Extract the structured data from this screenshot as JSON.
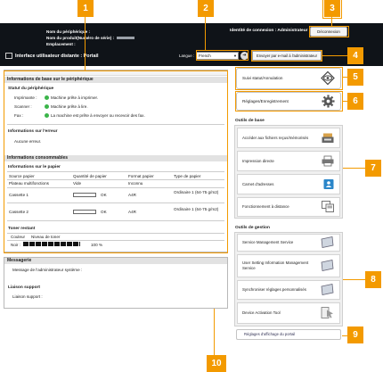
{
  "header": {
    "device_name_label": "Nom du périphérique :",
    "product_name_label": "Nom du produit(Numéro de série) :",
    "location_label": "Emplacement :",
    "login_label": "Identité de connexion :",
    "login_user": "Administrateur",
    "logout_button": "Déconnexion",
    "portal_title": "Interface utilisateur distante : Portail",
    "language_label": "Langue :",
    "language_value": "French",
    "email_admin_button": "Envoyer par e-mail à l'administrateur système"
  },
  "basic_info": {
    "title": "Informations de base sur le périphérique",
    "device_status_title": "Statut du périphérique",
    "status_rows": [
      {
        "label": "Imprimante :",
        "value": "Machine prête à imprimer."
      },
      {
        "label": "Scanner :",
        "value": "Machine prête à lire."
      },
      {
        "label": "Fax :",
        "value": "La machine est prête à envoyer ou recevoir des fax."
      }
    ],
    "error_title": "Informations sur l'erreur",
    "error_value": "Aucune erreur."
  },
  "consumables": {
    "title": "Informations consommables",
    "paper_title": "Informations sur le papier",
    "columns": [
      "Source papier",
      "Quantité de papier",
      "Format papier",
      "Type de papier"
    ],
    "rows": [
      {
        "source": "Plateau multifonctions",
        "qty": "Vide",
        "format": "Inconnu",
        "type": ""
      },
      {
        "source": "Cassette 1",
        "qty": "OK",
        "format": "A4R",
        "type": "Ordinaire 1 (64-75 g/m2)"
      },
      {
        "source": "Cassette 2",
        "qty": "OK",
        "format": "A4R",
        "type": "Ordinaire 1 (64-75 g/m2)"
      }
    ],
    "toner_title": "Toner restant",
    "toner_columns": [
      "Couleur",
      "Niveau de toner"
    ],
    "toner_color": "Noir :",
    "toner_level_text": "100 %",
    "toner_level": 100
  },
  "messages": {
    "title": "Messagerie",
    "admin_message_label": "Message de l'administrateur système :",
    "support_title": "Liaison support",
    "support_label": "Liaison support :"
  },
  "right": {
    "status_button": "Suivi statut/Annulation",
    "settings_button": "Réglages/Enregistrement",
    "basic_tools_title": "Outils de base",
    "basic_tools": [
      {
        "label": "Accéder aux fichiers reçus/mémorisés",
        "icon": "inbox-tray-icon"
      },
      {
        "label": "Impression directe",
        "icon": "printer-icon"
      },
      {
        "label": "Carnet d'adresses",
        "icon": "address-book-icon"
      },
      {
        "label": "Fonctionnement à distance",
        "icon": "remote-panel-icon"
      }
    ],
    "mgmt_tools_title": "Outils de gestion",
    "mgmt_tools": [
      {
        "label": "Service Management Service",
        "icon": "service-monitor-icon"
      },
      {
        "label": "User Setting Information Management Service",
        "icon": "user-setting-monitor-icon"
      },
      {
        "label": "Synchroniser réglages personnalisés",
        "icon": "sync-settings-icon"
      },
      {
        "label": "Device Activation Tool",
        "icon": "activation-tool-icon"
      }
    ],
    "portal_display_link": "Réglages d'affichage du portail"
  },
  "callouts": [
    "1",
    "2",
    "3",
    "4",
    "5",
    "6",
    "7",
    "8",
    "9",
    "10"
  ],
  "colors": {
    "accent": "#f39a00",
    "header": "#0f1318",
    "panel_header": "#e2e2e2",
    "status_ok": "#3bb54a"
  }
}
